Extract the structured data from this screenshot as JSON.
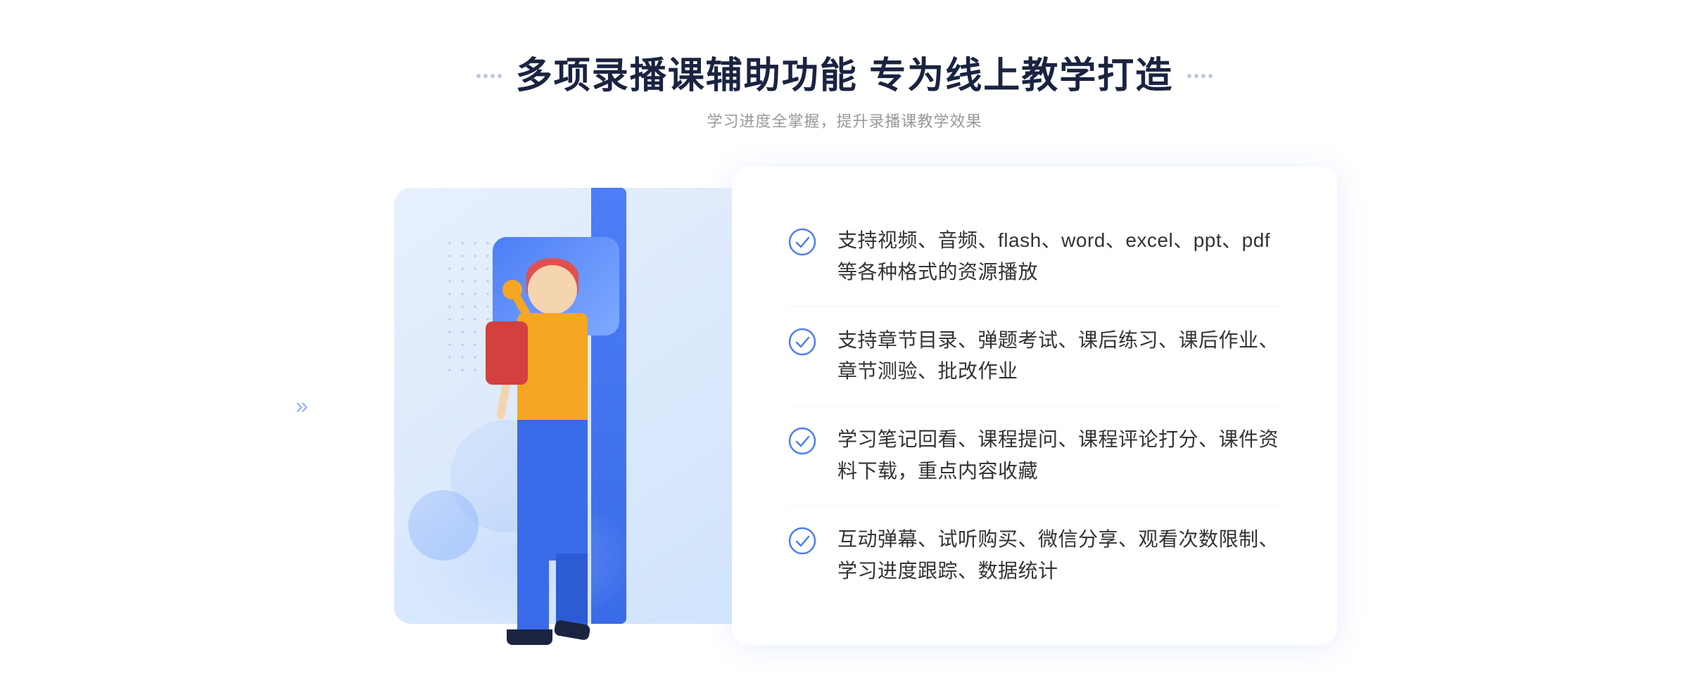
{
  "header": {
    "title": "多项录播课辅助功能 专为线上教学打造",
    "subtitle": "学习进度全掌握，提升录播课教学效果"
  },
  "features": [
    {
      "id": "feature-1",
      "text": "支持视频、音频、flash、word、excel、ppt、pdf等各种格式的资源播放"
    },
    {
      "id": "feature-2",
      "text": "支持章节目录、弹题考试、课后练习、课后作业、章节测验、批改作业"
    },
    {
      "id": "feature-3",
      "text": "学习笔记回看、课程提问、课程评论打分、课件资料下载，重点内容收藏"
    },
    {
      "id": "feature-4",
      "text": "互动弹幕、试听购买、微信分享、观看次数限制、学习进度跟踪、数据统计"
    }
  ],
  "icons": {
    "check_color": "#4d7ef7",
    "chevron": "»",
    "play": "▶"
  }
}
